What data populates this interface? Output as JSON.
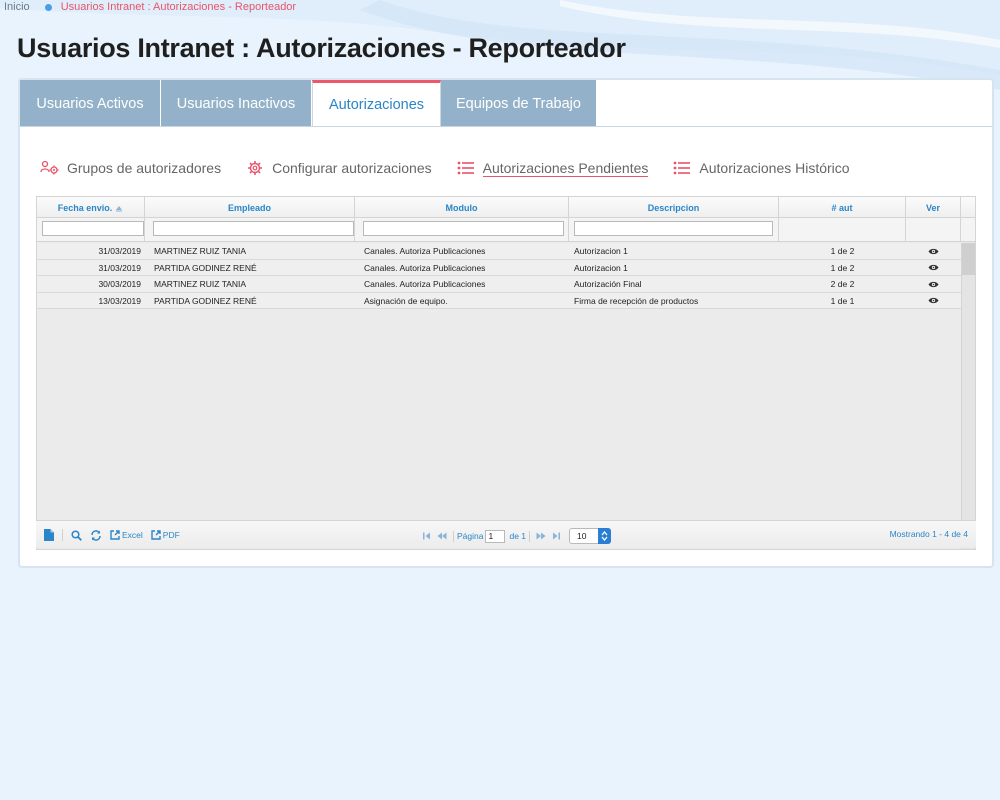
{
  "breadcrumb": {
    "home": "Inicio",
    "current": "Usuarios Intranet : Autorizaciones - Reporteador"
  },
  "page_title": "Usuarios Intranet : Autorizaciones - Reporteador",
  "tabs": [
    {
      "label": "Usuarios Activos"
    },
    {
      "label": "Usuarios Inactivos"
    },
    {
      "label": "Autorizaciones"
    },
    {
      "label": "Equipos de Trabajo"
    }
  ],
  "toolbar": {
    "groups": "Grupos de autorizadores",
    "configure": "Configurar autorizaciones",
    "pending": "Autorizaciones Pendientes",
    "history": "Autorizaciones Histórico"
  },
  "grid": {
    "headers": {
      "fecha": "Fecha envio.",
      "empleado": "Empleado",
      "modulo": "Modulo",
      "descripcion": "Descripcion",
      "aut": "# aut",
      "ver": "Ver"
    },
    "rows": [
      {
        "fecha": "31/03/2019",
        "empleado": "MARTINEZ RUIZ TANIA",
        "modulo": "Canales. Autoriza Publicaciones",
        "descripcion": "Autorizacion 1",
        "aut": "1 de 2"
      },
      {
        "fecha": "31/03/2019",
        "empleado": "PARTIDA GODINEZ RENÉ",
        "modulo": "Canales. Autoriza Publicaciones",
        "descripcion": "Autorizacion 1",
        "aut": "1 de 2"
      },
      {
        "fecha": "30/03/2019",
        "empleado": "MARTINEZ RUIZ TANIA",
        "modulo": "Canales. Autoriza Publicaciones",
        "descripcion": "Autorización Final",
        "aut": "2 de 2"
      },
      {
        "fecha": "13/03/2019",
        "empleado": "PARTIDA GODINEZ RENÉ",
        "modulo": "Asignación de equipo.",
        "descripcion": "Firma de recepción de productos",
        "aut": "1 de 1"
      }
    ]
  },
  "pager": {
    "excel": "Excel",
    "pdf": "PDF",
    "page_label": "Página",
    "page_value": "1",
    "of_label": "de 1",
    "page_size": "10",
    "summary": "Mostrando 1 - 4 de 4"
  },
  "colors": {
    "accent": "#2a86c8",
    "tab": "#93b2c9",
    "highlight": "#e8546a"
  }
}
